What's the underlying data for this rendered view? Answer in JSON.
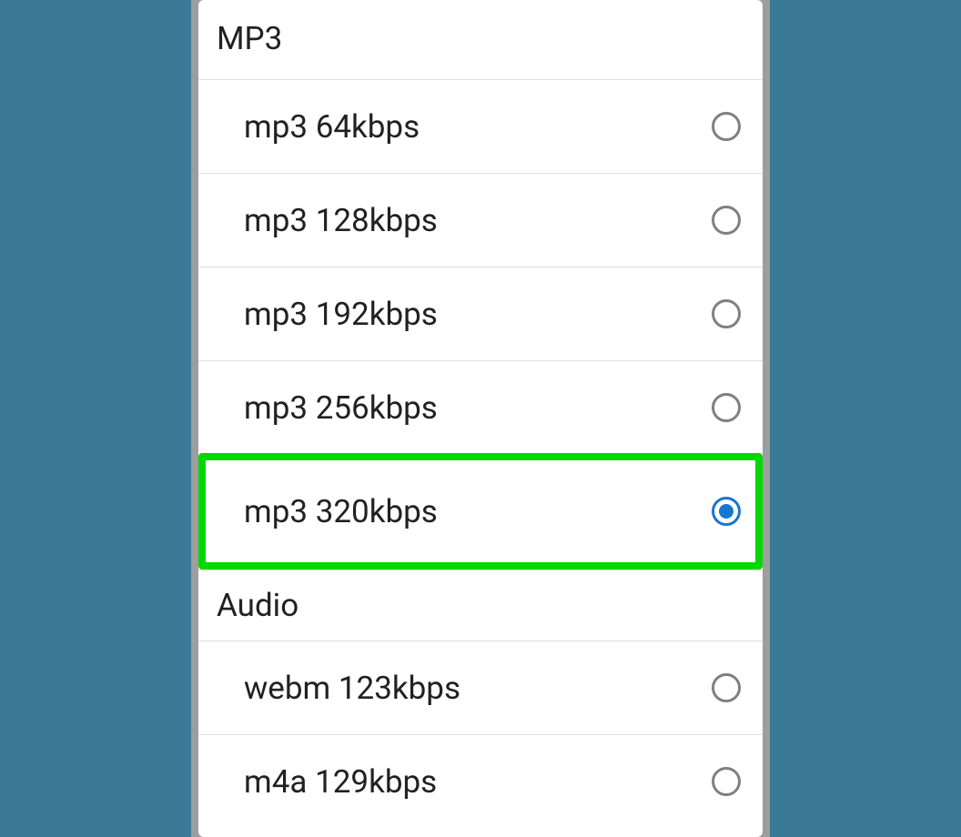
{
  "sections": [
    {
      "title": "MP3",
      "options": [
        {
          "label": "mp3 64kbps",
          "selected": false,
          "highlight": false
        },
        {
          "label": "mp3 128kbps",
          "selected": false,
          "highlight": false
        },
        {
          "label": "mp3 192kbps",
          "selected": false,
          "highlight": false
        },
        {
          "label": "mp3 256kbps",
          "selected": false,
          "highlight": false
        },
        {
          "label": "mp3 320kbps",
          "selected": true,
          "highlight": true
        }
      ]
    },
    {
      "title": "Audio",
      "options": [
        {
          "label": "webm 123kbps",
          "selected": false,
          "highlight": false
        },
        {
          "label": "m4a 129kbps",
          "selected": false,
          "highlight": false
        }
      ]
    }
  ]
}
